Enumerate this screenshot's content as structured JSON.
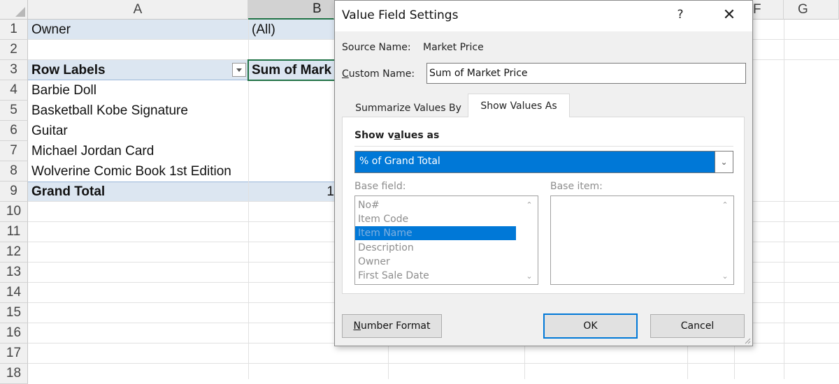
{
  "sheet": {
    "columns": [
      "A",
      "B",
      "F",
      "G"
    ],
    "rows": [
      "1",
      "2",
      "3",
      "4",
      "5",
      "6",
      "7",
      "8",
      "9",
      "10",
      "11",
      "12",
      "13",
      "14",
      "15",
      "16",
      "17",
      "18"
    ],
    "filter_label": "Owner",
    "filter_value": "(All)",
    "row_labels_header": "Row Labels",
    "values_header": "Sum of Mark",
    "items": [
      "Barbie Doll",
      "Basketball Kobe Signature",
      "Guitar",
      "Michael Jordan Card",
      "Wolverine Comic Book 1st Edition"
    ],
    "grand_total_label": "Grand Total",
    "grand_total_value_fragment": "1"
  },
  "dialog": {
    "title": "Value Field Settings",
    "help_icon": "?",
    "close_icon": "✕",
    "source_name_label": "Source Name:",
    "source_name_value": "Market Price",
    "custom_name_label_prefix": "C",
    "custom_name_label_rest": "ustom Name:",
    "custom_name_value": "Sum of Market Price",
    "tabs": {
      "summarize": "Summarize Values By",
      "show_as": "Show Values As"
    },
    "show_values_as_label_a": "Show v",
    "show_values_as_label_u": "a",
    "show_values_as_label_b": "lues as",
    "show_values_as_value": "% of Grand Total",
    "base_field_label": "Base field:",
    "base_item_label": "Base item:",
    "base_fields": [
      "No#",
      "Item Code",
      "Item Name",
      "Description",
      "Owner",
      "First Sale Date"
    ],
    "selected_base_field": "Item Name",
    "number_format_prefix": "N",
    "number_format_rest": "umber Format",
    "ok_label": "OK",
    "cancel_label": "Cancel",
    "accent_color": "#0078d7"
  }
}
